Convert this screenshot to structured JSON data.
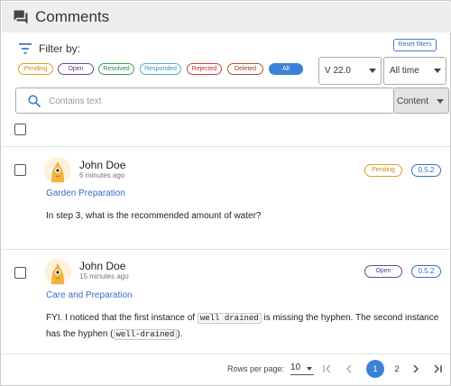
{
  "header": {
    "title": "Comments",
    "icon": "comments-icon"
  },
  "filter": {
    "label": "Filter by:",
    "reset_label": "Reset filters",
    "chips": {
      "pending": "Pending",
      "open": "Open",
      "resolved": "Resolved",
      "responded": "Responded",
      "rejected": "Rejected",
      "deleted": "Deleted",
      "all": "All"
    },
    "selected_chip": "All",
    "version_value": "V 22.0",
    "time_value": "All time"
  },
  "search": {
    "placeholder": "Contains text",
    "value": "",
    "scope_value": "Content"
  },
  "comments": [
    {
      "author": "John Doe",
      "time": "6 minutes ago",
      "topic": "Garden Preparation",
      "status": "Pending",
      "version": "0.5.2",
      "body": "In step 3, what is the recommended amount of water?"
    },
    {
      "author": "John Doe",
      "time": "15 minutes ago",
      "topic": "Care and Preparation",
      "status": "Open",
      "version": "0.5.2",
      "body_part1": "FYI. I noticed that the first instance of ",
      "code1": "well drained",
      "body_part2": " is missing the hyphen. The second instance has the hyphen (",
      "code2": "well-drained",
      "body_part3": ")."
    }
  ],
  "pagination": {
    "rows_label": "Rows per page:",
    "rows_value": "10",
    "pages": [
      "1",
      "2"
    ],
    "current_page": "1"
  },
  "colors": {
    "accent": "#3b82d6",
    "pending": "#e0a020",
    "open": "#6b45a0",
    "resolved": "#3aa050",
    "responded": "#55a8d8",
    "rejected": "#d04040",
    "deleted": "#b05030",
    "avatar": "#f2b33d"
  }
}
